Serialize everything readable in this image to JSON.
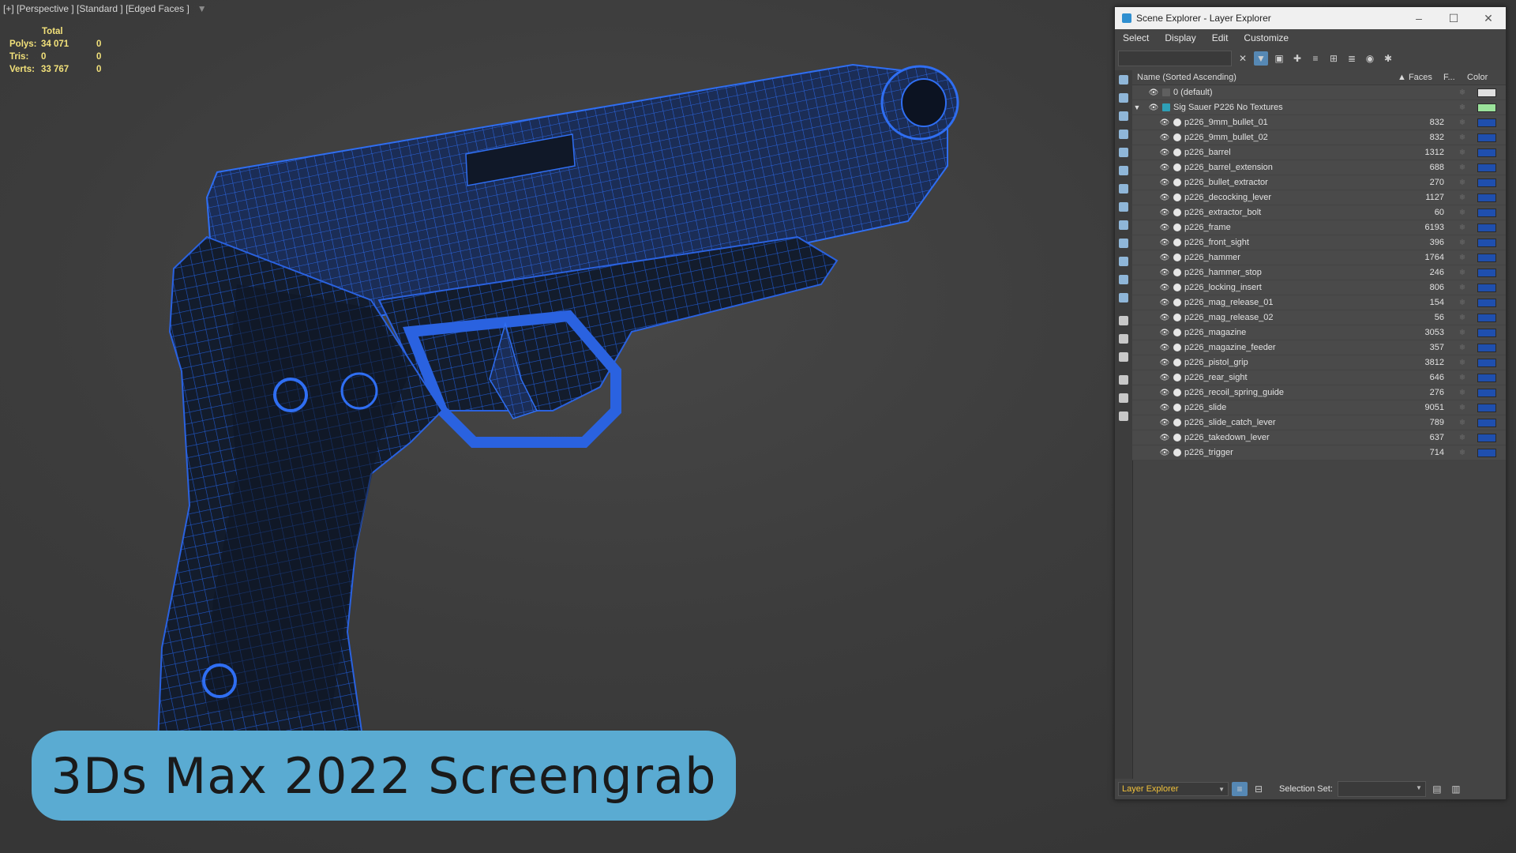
{
  "viewport": {
    "label": "[+] [Perspective ] [Standard ] [Edged Faces ]",
    "stats": {
      "header": "Total",
      "rows": [
        {
          "key": "Polys:",
          "total": "34 071",
          "sel": "0"
        },
        {
          "key": "Tris:",
          "total": "0",
          "sel": "0"
        },
        {
          "key": "Verts:",
          "total": "33 767",
          "sel": "0"
        }
      ]
    }
  },
  "caption": "3Ds Max 2022 Screengrab",
  "explorer": {
    "title": "Scene Explorer - Layer Explorer",
    "window_buttons": {
      "minimize": "–",
      "maximize": "☐",
      "close": "✕"
    },
    "menu": [
      "Select",
      "Display",
      "Edit",
      "Customize"
    ],
    "search_value": "",
    "columns": {
      "name": "Name (Sorted Ascending)",
      "faces": "▲ Faces",
      "frozen": "F...",
      "color": "Color"
    },
    "default_layer": {
      "name": "0 (default)",
      "color": "#e0e0e0"
    },
    "group_layer": {
      "name": "Sig Sauer P226 No Textures",
      "color": "#9be39b"
    },
    "object_color": "#1f4fae",
    "objects": [
      {
        "name": "p226_9mm_bullet_01",
        "faces": "832"
      },
      {
        "name": "p226_9mm_bullet_02",
        "faces": "832"
      },
      {
        "name": "p226_barrel",
        "faces": "1312"
      },
      {
        "name": "p226_barrel_extension",
        "faces": "688"
      },
      {
        "name": "p226_bullet_extractor",
        "faces": "270"
      },
      {
        "name": "p226_decocking_lever",
        "faces": "1127"
      },
      {
        "name": "p226_extractor_bolt",
        "faces": "60"
      },
      {
        "name": "p226_frame",
        "faces": "6193"
      },
      {
        "name": "p226_front_sight",
        "faces": "396"
      },
      {
        "name": "p226_hammer",
        "faces": "1764"
      },
      {
        "name": "p226_hammer_stop",
        "faces": "246"
      },
      {
        "name": "p226_locking_insert",
        "faces": "806"
      },
      {
        "name": "p226_mag_release_01",
        "faces": "154"
      },
      {
        "name": "p226_mag_release_02",
        "faces": "56"
      },
      {
        "name": "p226_magazine",
        "faces": "3053"
      },
      {
        "name": "p226_magazine_feeder",
        "faces": "357"
      },
      {
        "name": "p226_pistol_grip",
        "faces": "3812"
      },
      {
        "name": "p226_rear_sight",
        "faces": "646"
      },
      {
        "name": "p226_recoil_spring_guide",
        "faces": "276"
      },
      {
        "name": "p226_slide",
        "faces": "9051"
      },
      {
        "name": "p226_slide_catch_lever",
        "faces": "789"
      },
      {
        "name": "p226_takedown_lever",
        "faces": "637"
      },
      {
        "name": "p226_trigger",
        "faces": "714"
      }
    ],
    "bottom": {
      "explorer_dropdown": "Layer Explorer",
      "selection_set_label": "Selection Set:",
      "selection_set_value": ""
    }
  }
}
